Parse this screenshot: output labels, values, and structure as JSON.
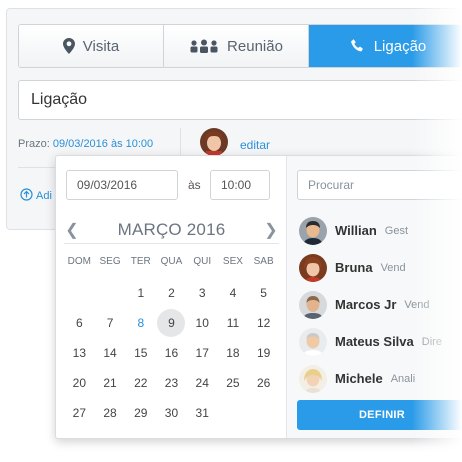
{
  "tabs": [
    {
      "label": "Visita",
      "icon": "map-pin-icon"
    },
    {
      "label": "Reunião",
      "icon": "group-icon"
    },
    {
      "label": "Ligação",
      "icon": "phone-icon",
      "active": true
    }
  ],
  "title_value": "Ligação",
  "prazo": {
    "label": "Prazo:",
    "value": "09/03/2016 às 10:00"
  },
  "editar_label": "editar",
  "add_label": "Adi",
  "picker": {
    "date_value": "09/03/2016",
    "as_label": "às",
    "time_value": "10:00",
    "month_title": "MARÇO 2016",
    "weekdays": [
      "DOM",
      "SEG",
      "TER",
      "QUA",
      "QUI",
      "SEX",
      "SAB"
    ],
    "weeks": [
      [
        "",
        "",
        "1",
        "2",
        "3",
        "4",
        "5"
      ],
      [
        "6",
        "7",
        "8",
        "9",
        "10",
        "11",
        "12"
      ],
      [
        "13",
        "14",
        "15",
        "16",
        "17",
        "18",
        "19"
      ],
      [
        "20",
        "21",
        "22",
        "23",
        "24",
        "25",
        "26"
      ],
      [
        "27",
        "28",
        "29",
        "30",
        "31",
        "",
        ""
      ]
    ],
    "today_day": "8",
    "selected_day": "9"
  },
  "assignee": {
    "search_placeholder": "Procurar",
    "people": [
      {
        "name": "Willian",
        "role": "Gest"
      },
      {
        "name": "Bruna",
        "role": "Vend"
      },
      {
        "name": "Marcos Jr",
        "role": "Vend"
      },
      {
        "name": "Mateus Silva",
        "role": "Dire"
      },
      {
        "name": "Michele",
        "role": "Anali"
      }
    ],
    "button_label": "DEFINIR"
  },
  "colors": {
    "accent": "#2a9be8",
    "link": "#2a8fd8"
  }
}
